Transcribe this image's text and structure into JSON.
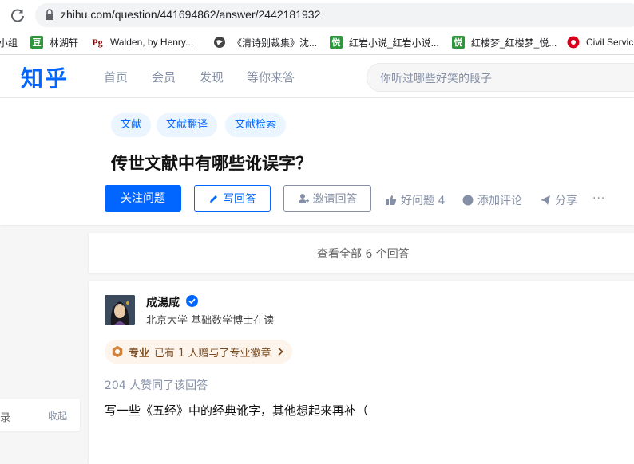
{
  "browser": {
    "url": "zhihu.com/question/441694862/answer/2442181932",
    "bookmarks": [
      {
        "label": "小组",
        "icon": "partial-icon",
        "color": "#00b51d"
      },
      {
        "label": "林湖轩",
        "icon": "douban-icon",
        "color": "#2e963d"
      },
      {
        "label": "Walden, by Henry...",
        "icon": "gutenberg-icon",
        "color": "#8b0000"
      },
      {
        "label": "《清诗别裁集》沈...",
        "icon": "globe-icon",
        "color": "#444444"
      },
      {
        "label": "红岩小说_红岩小说...",
        "icon": "yue-icon",
        "color": "#2e963d"
      },
      {
        "label": "红楼梦_红楼梦_悦...",
        "icon": "yue-icon",
        "color": "#2e963d"
      },
      {
        "label": "Civil Servic",
        "icon": "hk-icon",
        "color": "#d6001c"
      }
    ]
  },
  "header": {
    "logo": "知乎",
    "nav": [
      "首页",
      "会员",
      "发现",
      "等你来答"
    ],
    "search_placeholder": "你听过哪些好笑的段子"
  },
  "question": {
    "tags": [
      "文献",
      "文献翻译",
      "文献检索"
    ],
    "title": "传世文献中有哪些讹误字？",
    "follow_label": "关注问题",
    "write_label": "写回答",
    "invite_label": "邀请回答",
    "good_question_label": "好问题 4",
    "comment_label": "添加评论",
    "share_label": "分享",
    "more_label": "···"
  },
  "view_all": "查看全部 6 个回答",
  "answer": {
    "author_name": "成湯咸",
    "author_bio": "北京大学 基础数学博士在读",
    "badge_label": "专业",
    "badge_text": "已有 1 人赠与了专业徽章",
    "votes": "204 人赞同了该回答",
    "content": "写一些《五经》中的经典讹字，其他想起来再补（"
  },
  "side": {
    "label": "录",
    "collapse": "收起"
  },
  "colors": {
    "brand": "#0066ff",
    "muted": "#8590a6",
    "tag_bg": "#ebf5ff"
  }
}
